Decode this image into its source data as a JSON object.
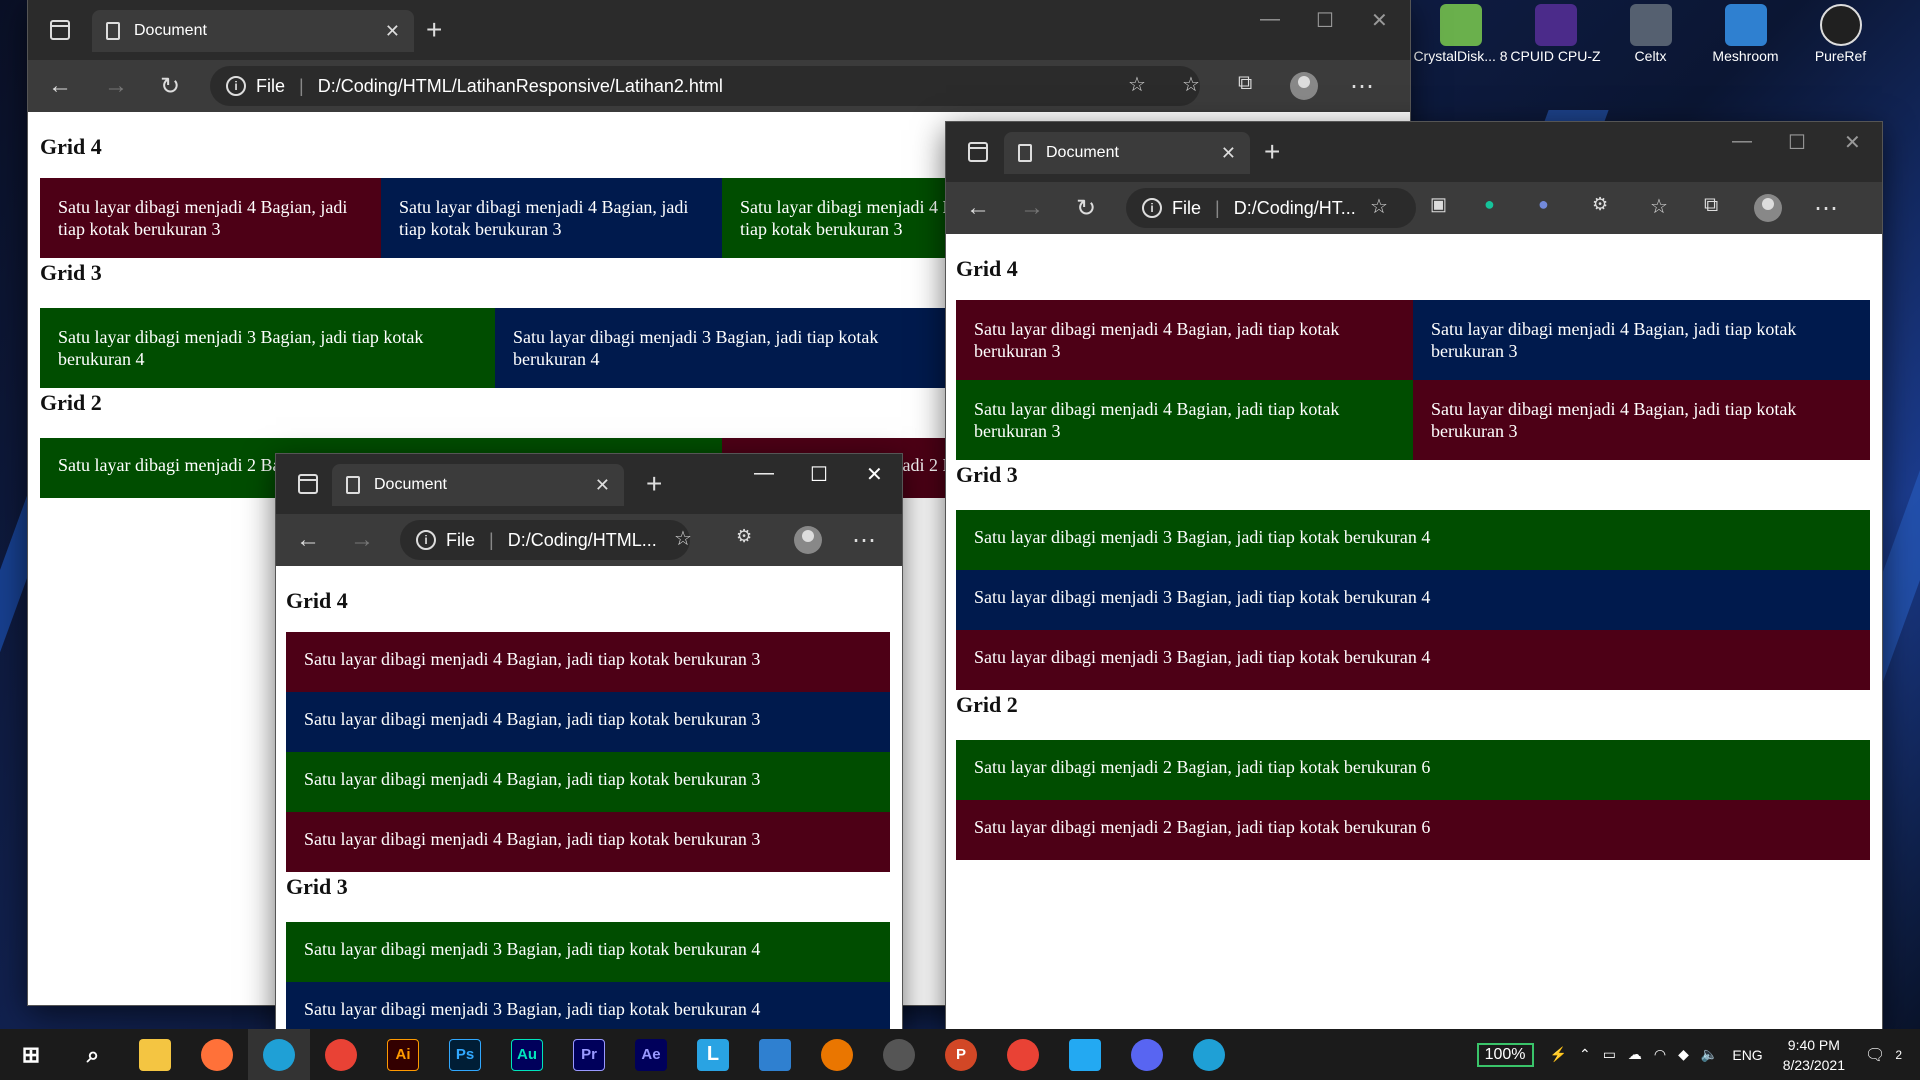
{
  "desktop": {
    "icons": [
      {
        "label": "CrystalDisk... 8",
        "color": "#6ab04c"
      },
      {
        "label": "CPUID CPU-Z",
        "color": "#4b2b8a"
      },
      {
        "label": "Celtx",
        "color": "#556070"
      },
      {
        "label": "Meshroom",
        "color": "#2f80d0"
      },
      {
        "label": "PureRef",
        "color": "#202020"
      }
    ]
  },
  "window_main": {
    "tab_title": "Document",
    "address_prefix": "File",
    "address": "D:/Coding/HTML/LatihanResponsive/Latihan2.html",
    "grid4_heading": "Grid 4",
    "grid4_cells": [
      "Satu layar dibagi menjadi 4 Bagian, jadi tiap kotak berukuran 3",
      "Satu layar dibagi menjadi 4 Bagian, jadi tiap kotak berukuran 3",
      "Satu layar dibagi menjadi 4 Bagian, jadi tiap kotak berukuran 3"
    ],
    "grid3_heading": "Grid 3",
    "grid3_cells": [
      "Satu layar dibagi menjadi 3 Bagian, jadi tiap kotak berukuran 4",
      "Satu layar dibagi menjadi 3 Bagian, jadi tiap kotak berukuran 4"
    ],
    "grid2_heading": "Grid 2",
    "grid2_cells": [
      "Satu layar dibagi menjadi 2 Bagian, jadi tiap kotak berukuran 6",
      "Satu layar dibagi menjadi 2 Bagian, jadi tiap kotak berukuran 6"
    ]
  },
  "window_right": {
    "tab_title": "Document",
    "address_prefix": "File",
    "address": "D:/Coding/HT...",
    "grid4_heading": "Grid 4",
    "grid4_cells": [
      "Satu layar dibagi menjadi 4 Bagian, jadi tiap kotak berukuran 3",
      "Satu layar dibagi menjadi 4 Bagian, jadi tiap kotak berukuran 3",
      "Satu layar dibagi menjadi 4 Bagian, jadi tiap kotak berukuran 3",
      "Satu layar dibagi menjadi 4 Bagian, jadi tiap kotak berukuran 3"
    ],
    "grid3_heading": "Grid 3",
    "grid3_cells": [
      "Satu layar dibagi menjadi 3 Bagian, jadi tiap kotak berukuran 4",
      "Satu layar dibagi menjadi 3 Bagian, jadi tiap kotak berukuran 4",
      "Satu layar dibagi menjadi 3 Bagian, jadi tiap kotak berukuran 4"
    ],
    "grid2_heading": "Grid 2",
    "grid2_cells": [
      "Satu layar dibagi menjadi 2 Bagian, jadi tiap kotak berukuran 6",
      "Satu layar dibagi menjadi 2 Bagian, jadi tiap kotak berukuran 6"
    ]
  },
  "window_small": {
    "tab_title": "Document",
    "address_prefix": "File",
    "address": "D:/Coding/HTML...",
    "grid4_heading": "Grid 4",
    "grid4_cells": [
      "Satu layar dibagi menjadi 4 Bagian, jadi tiap kotak berukuran 3",
      "Satu layar dibagi menjadi 4 Bagian, jadi tiap kotak berukuran 3",
      "Satu layar dibagi menjadi 4 Bagian, jadi tiap kotak berukuran 3",
      "Satu layar dibagi menjadi 4 Bagian, jadi tiap kotak berukuran 3"
    ],
    "grid3_heading": "Grid 3",
    "grid3_cells": [
      "Satu layar dibagi menjadi 3 Bagian, jadi tiap kotak berukuran 4",
      "Satu layar dibagi menjadi 3 Bagian, jadi tiap kotak berukuran 4"
    ]
  },
  "taskbar": {
    "apps": [
      {
        "name": "file-explorer",
        "label": "",
        "color": "#f4c542"
      },
      {
        "name": "firefox",
        "label": "",
        "color": "#ff7139"
      },
      {
        "name": "edge",
        "label": "",
        "color": "#1fa0d6"
      },
      {
        "name": "chrome",
        "label": "",
        "color": "#e94235"
      },
      {
        "name": "illustrator",
        "label": "Ai",
        "color": "#ff9a00"
      },
      {
        "name": "photoshop",
        "label": "Ps",
        "color": "#31a8ff"
      },
      {
        "name": "audition",
        "label": "Au",
        "color": "#00e4bb"
      },
      {
        "name": "premiere",
        "label": "Pr",
        "color": "#9999ff"
      },
      {
        "name": "after-effects",
        "label": "Ae",
        "color": "#9999ff"
      },
      {
        "name": "l-app",
        "label": "L",
        "color": "#29a3e3"
      },
      {
        "name": "mail",
        "label": "",
        "color": "#2f80d0"
      },
      {
        "name": "blender",
        "label": "",
        "color": "#ea7600"
      },
      {
        "name": "obs",
        "label": "",
        "color": "#555"
      },
      {
        "name": "powerpoint",
        "label": "P",
        "color": "#d24726"
      },
      {
        "name": "chrome-alt",
        "label": "",
        "color": "#e94235"
      },
      {
        "name": "vscode",
        "label": "",
        "color": "#23a9f2"
      },
      {
        "name": "discord",
        "label": "",
        "color": "#5865f2"
      },
      {
        "name": "edge-alt",
        "label": "",
        "color": "#1fa0d6"
      }
    ],
    "battery": "100%",
    "language": "ENG",
    "time": "9:40 PM",
    "date": "8/23/2021",
    "notifications": "2"
  }
}
